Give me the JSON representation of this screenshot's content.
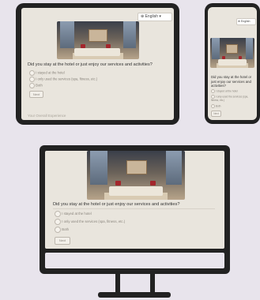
{
  "survey": {
    "language_label": "English",
    "question": "Did you stay at the hotel or just enjoy our services and activities?",
    "options": [
      "I stayed at the hotel",
      "I only used the services (spa, fitness, etc.)",
      "Both"
    ],
    "next_label": "Next",
    "footer_section": "Your Overall Experience"
  },
  "icons": {
    "globe": "globe-icon",
    "chevron": "chevron-down-icon"
  },
  "colors": {
    "device_frame": "#222222",
    "screen_bg": "#e9e5dd",
    "accent_red": "#a3262c"
  }
}
